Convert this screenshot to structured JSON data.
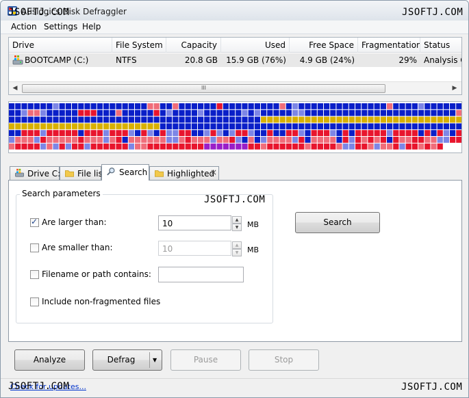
{
  "window": {
    "title": "Auslogics Disk Defraggler"
  },
  "watermarks": {
    "top_left": "JSOFTJ.COM",
    "top_right": "JSOFTJ.COM",
    "middle": "JSOFTJ.COM",
    "bottom_left": "JSOFTJ.COM",
    "bottom_right": "JSOFTJ.COM"
  },
  "menu": [
    "Action",
    "Settings",
    "Help"
  ],
  "drives": {
    "columns": [
      "Drive",
      "File System",
      "Capacity",
      "Used",
      "Free Space",
      "Fragmentation",
      "Status"
    ],
    "rows": [
      {
        "drive": "BOOTCAMP (C:)",
        "fs": "NTFS",
        "capacity": "20.8 GB",
        "used": "15.9 GB (76%)",
        "free": "4.9 GB (24%)",
        "frag": "29%",
        "status": "Analysis Co"
      }
    ],
    "scroll_thumb": "III"
  },
  "cluster_map": {
    "colors": {
      "free": "#ffffff",
      "contiguous": "#0a1fc8",
      "light": "#7d86e6",
      "fragmented": "#e8152d",
      "pink": "#f06d7a",
      "system": "#d8b000",
      "mft": "#9a1ec8"
    }
  },
  "tabs": [
    "Drive C:",
    "File list",
    "Search",
    "Highlighted"
  ],
  "tab_close": "×",
  "search": {
    "group_title": "Search parameters",
    "larger": {
      "label": "Are larger than:",
      "checked": true,
      "value": "10",
      "unit": "MB"
    },
    "smaller": {
      "label": "Are smaller than:",
      "checked": false,
      "value": "10",
      "unit": "MB"
    },
    "filename": {
      "label": "Filename or path contains:",
      "checked": false,
      "value": ""
    },
    "nonfrag": {
      "label": "Include non-fragmented files",
      "checked": false
    },
    "search_button": "Search"
  },
  "actions": {
    "analyze": "Analyze",
    "defrag": "Defrag",
    "pause": "Pause",
    "stop": "Stop"
  },
  "footer": {
    "link": "Check for updates..."
  }
}
